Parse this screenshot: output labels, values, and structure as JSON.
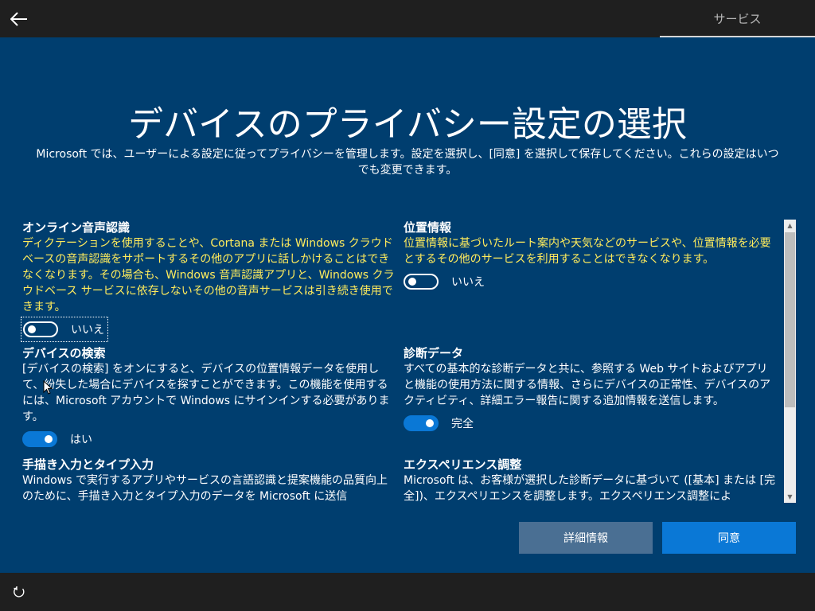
{
  "header": {
    "back_icon": "arrow-left-icon",
    "service_tab": "サービス"
  },
  "title": "デバイスのプライバシー設定の選択",
  "subtitle": "Microsoft では、ユーザーによる設定に従ってプライバシーを管理します。設定を選択し、[同意] を選択して保存してください。これらの設定はいつでも変更できます。",
  "settings": {
    "speech": {
      "title": "オンライン音声認識",
      "description": "ディクテーションを使用することや、Cortana または Windows クラウドベースの音声認識をサポートするその他のアプリに話しかけることはできなくなります。その場合も、Windows 音声認識アプリと、Windows クラウドベース サービスに依存しないその他の音声サービスは引き続き使用できます。",
      "state": "off",
      "label": "いいえ"
    },
    "location": {
      "title": "位置情報",
      "description": "位置情報に基づいたルート案内や天気などのサービスや、位置情報を必要とするその他のサービスを利用することはできなくなります。",
      "state": "off",
      "label": "いいえ"
    },
    "find_device": {
      "title": "デバイスの検索",
      "description": "[デバイスの検索] をオンにすると、デバイスの位置情報データを使用して、紛失した場合にデバイスを探すことができます。この機能を使用するには、Microsoft アカウントで Windows にサインインする必要があります。",
      "state": "on",
      "label": "はい"
    },
    "diagnostics": {
      "title": "診断データ",
      "description": "すべての基本的な診断データと共に、参照する Web サイトおよびアプリと機能の使用方法に関する情報、さらにデバイスの正常性、デバイスのアクティビティ、詳細エラー報告に関する追加情報を送信します。",
      "state": "on",
      "label": "完全"
    },
    "inking": {
      "title": "手描き入力とタイプ入力",
      "description": "Windows で実行するアプリやサービスの言語認識と提案機能の品質向上のために、手描き入力とタイプ入力のデータを Microsoft に送信"
    },
    "experience": {
      "title": "エクスペリエンス調整",
      "description": "Microsoft は、お客様が選択した診断データに基づいて ([基本] または [完全])、エクスペリエンスを調整します。エクスペリエンス調整によ"
    }
  },
  "buttons": {
    "details": "詳細情報",
    "agree": "同意"
  },
  "footer": {
    "ease_icon": "ease-of-access-icon"
  },
  "colors": {
    "background": "#003e6f",
    "warning_text": "#ffec5c",
    "toggle_on": "#0a78d6",
    "primary_button": "#0a78d6",
    "secondary_button": "#4a6f93"
  }
}
